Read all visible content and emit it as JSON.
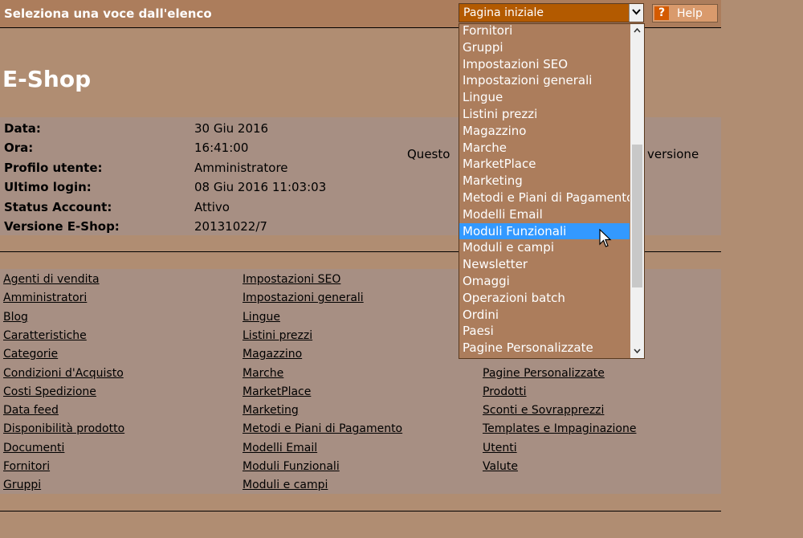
{
  "header": {
    "title": "Seleziona una voce dall'elenco",
    "select_value": "Pagina iniziale",
    "help_label": "Help",
    "help_icon": "?"
  },
  "brand": "E-Shop",
  "info": {
    "rows": [
      {
        "label": "Data:",
        "value": "30 Giu 2016"
      },
      {
        "label": "Ora:",
        "value": "16:41:00"
      },
      {
        "label": "Profilo utente:",
        "value": "Amministratore"
      },
      {
        "label": "Ultimo login:",
        "value": "08 Giu 2016 11:03:03"
      },
      {
        "label": "Status Account:",
        "value": "Attivo"
      },
      {
        "label": "Versione E-Shop:",
        "value": "20131022/7"
      }
    ],
    "note_start": "Questo",
    "note_end": "versione"
  },
  "links": {
    "col1": [
      "Agenti di vendita",
      "Amministratori",
      "Blog",
      "Caratteristiche",
      "Categorie",
      "Condizioni d'Acquisto",
      "Costi Spedizione",
      "Data feed",
      "Disponibilità prodotto",
      "Documenti",
      "Fornitori",
      "Gruppi"
    ],
    "col2": [
      "Impostazioni SEO",
      "Impostazioni generali",
      "Lingue",
      "Listini prezzi",
      "Magazzino",
      "Marche",
      "MarketPlace",
      "Marketing",
      "Metodi e Piani di Pagamento",
      "Modelli Email",
      "Moduli Funzionali",
      "Moduli e campi"
    ],
    "col3": [
      "Pagine Personalizzate",
      "Prodotti",
      "Sconti e Sovrapprezzi",
      "Templates e Impaginazione",
      "Utenti",
      "Valute"
    ]
  },
  "dropdown": {
    "items": [
      "Fornitori",
      "Gruppi",
      "Impostazioni SEO",
      "Impostazioni generali",
      "Lingue",
      "Listini prezzi",
      "Magazzino",
      "Marche",
      "MarketPlace",
      "Marketing",
      "Metodi e Piani di Pagamento",
      "Modelli Email",
      "Moduli Funzionali",
      "Moduli e campi",
      "Newsletter",
      "Omaggi",
      "Operazioni batch",
      "Ordini",
      "Paesi",
      "Pagine Personalizzate"
    ],
    "selected": "Moduli Funzionali"
  },
  "colors": {
    "top_bar": "#ac7d5c",
    "select_bg": "#b35a00",
    "selection": "#3399ff",
    "panel": "#a78f83",
    "background": "#b08d72"
  }
}
